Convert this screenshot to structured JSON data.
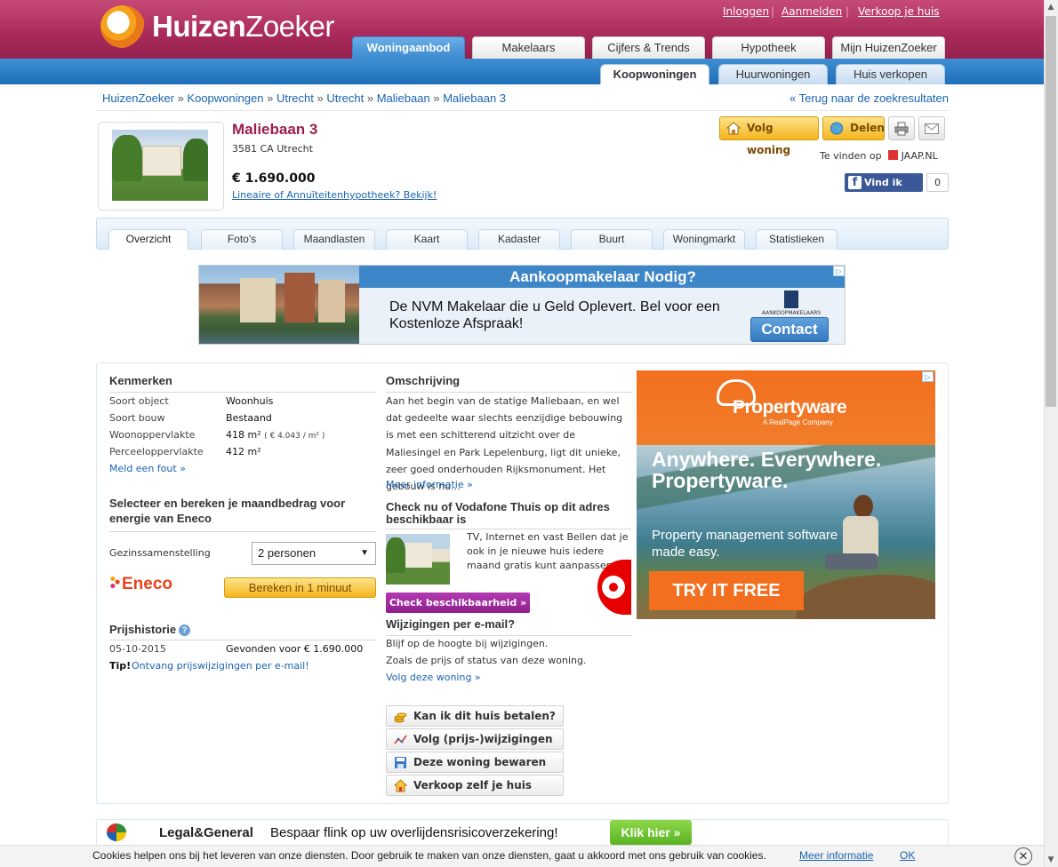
{
  "header": {
    "logo": {
      "bold": "Huizen",
      "regular": "Zoeker"
    },
    "toplinks": {
      "login": "Inloggen",
      "register": "Aanmelden",
      "sell": "Verkoop je huis",
      "sep": "|"
    },
    "main_tabs": [
      "Woningaanbod",
      "Makelaars",
      "Cijfers & Trends",
      "Hypotheek",
      "Mijn HuizenZoeker"
    ],
    "sub_tabs": [
      "Koopwoningen",
      "Huurwoningen",
      "Huis verkopen"
    ]
  },
  "breadcrumb": {
    "items": [
      "HuizenZoeker",
      "Koopwoningen",
      "Utrecht",
      "Utrecht",
      "Maliebaan",
      "Maliebaan 3"
    ],
    "sep": "»",
    "back": "« Terug naar de zoekresultaten"
  },
  "property": {
    "title": "Maliebaan 3",
    "address": "3581 CA Utrecht",
    "price": "€ 1.690.000",
    "mortgage_link": "Lineaire of Annuïteitenhypotheek? Bekijk!",
    "follow_btn": "Volg woning",
    "share_btn": "Delen",
    "found_on": "Te vinden op",
    "found_site": "JAAP.NL",
    "fb_like": "Vind ik leuk",
    "fb_count": "0"
  },
  "detail_tabs": [
    "Overzicht",
    "Foto's",
    "Maandlasten",
    "Kaart",
    "Kadaster",
    "Buurt",
    "Woningmarkt",
    "Statistieken"
  ],
  "banner_ad": {
    "heading": "Aankoopmakelaar Nodig?",
    "text": "De NVM Makelaar die u Geld Oplevert. Bel voor een Kostenloze Afspraak!",
    "logo": "AANKOOPMAKELAARS",
    "cta": "Contact"
  },
  "kenmerken": {
    "heading": "Kenmerken",
    "rows": [
      {
        "k": "Soort object",
        "v": "Woonhuis"
      },
      {
        "k": "Soort bouw",
        "v": "Bestaand"
      },
      {
        "k": "Woonoppervlakte",
        "v": "418 m²",
        "extra": "( € 4.043 / m² )"
      },
      {
        "k": "Perceeloppervlakte",
        "v": "412 m²"
      }
    ],
    "report": "Meld een fout »"
  },
  "energy": {
    "heading": "Selecteer en bereken je maandbedrag voor energie van Eneco",
    "label": "Gezinssamenstelling",
    "selected": "2 personen",
    "brand": "Eneco",
    "button": "Bereken in 1 minuut"
  },
  "prijshistorie": {
    "heading": "Prijshistorie",
    "date": "05-10-2015",
    "event": "Gevonden voor € 1.690.000",
    "tip_label": "Tip!",
    "tip_link": "Ontvang prijswijzigingen per e-mail!"
  },
  "omschrijving": {
    "heading": "Omschrijving",
    "text": "Aan het begin van de statige Maliebaan, en wel dat gedeelte waar slechts eenzijdige bebouwing is met een schitterend uitzicht over de Maliesingel en Park Lepelenburg, ligt dit unieke, zeer goed onderhouden Rijksmonument. Het gebouw is nu...",
    "more": "Meer informatie »"
  },
  "vodafone": {
    "heading": "Check nu of Vodafone Thuis op dit adres beschikbaar is",
    "text": "TV, Internet en vast Bellen dat je ook in je nieuwe huis iedere maand gratis kunt aanpassen",
    "button": "Check beschikbaarheid »"
  },
  "email": {
    "heading": "Wijzigingen per e-mail?",
    "line1": "Blijf op de hoogte bij wijzigingen.",
    "line2": "Zoals de prijs of status van deze woning.",
    "link": "Volg deze woning »"
  },
  "actions": [
    "Kan ik dit huis betalen?",
    "Volg (prijs-)wijzigingen",
    "Deze woning bewaren",
    "Verkoop zelf je huis"
  ],
  "side_ad": {
    "brand": "Propertyware",
    "tagline": "A RealPage Company",
    "headline": "Anywhere. Everywhere. Propertyware.",
    "sub": "Property management software made easy.",
    "cta": "TRY IT FREE"
  },
  "bottom_ad": {
    "brand": "Legal&General",
    "text": "Bespaar flink op uw overlijdensrisicoverzekering!",
    "cta": "Klik hier »"
  },
  "cookie": {
    "text": "Cookies helpen ons bij het leveren van onze diensten. Door gebruik te maken van onze diensten, gaat u akkoord met ons gebruik van cookies.",
    "more": "Meer informatie",
    "ok": "OK",
    "close": "✕"
  }
}
